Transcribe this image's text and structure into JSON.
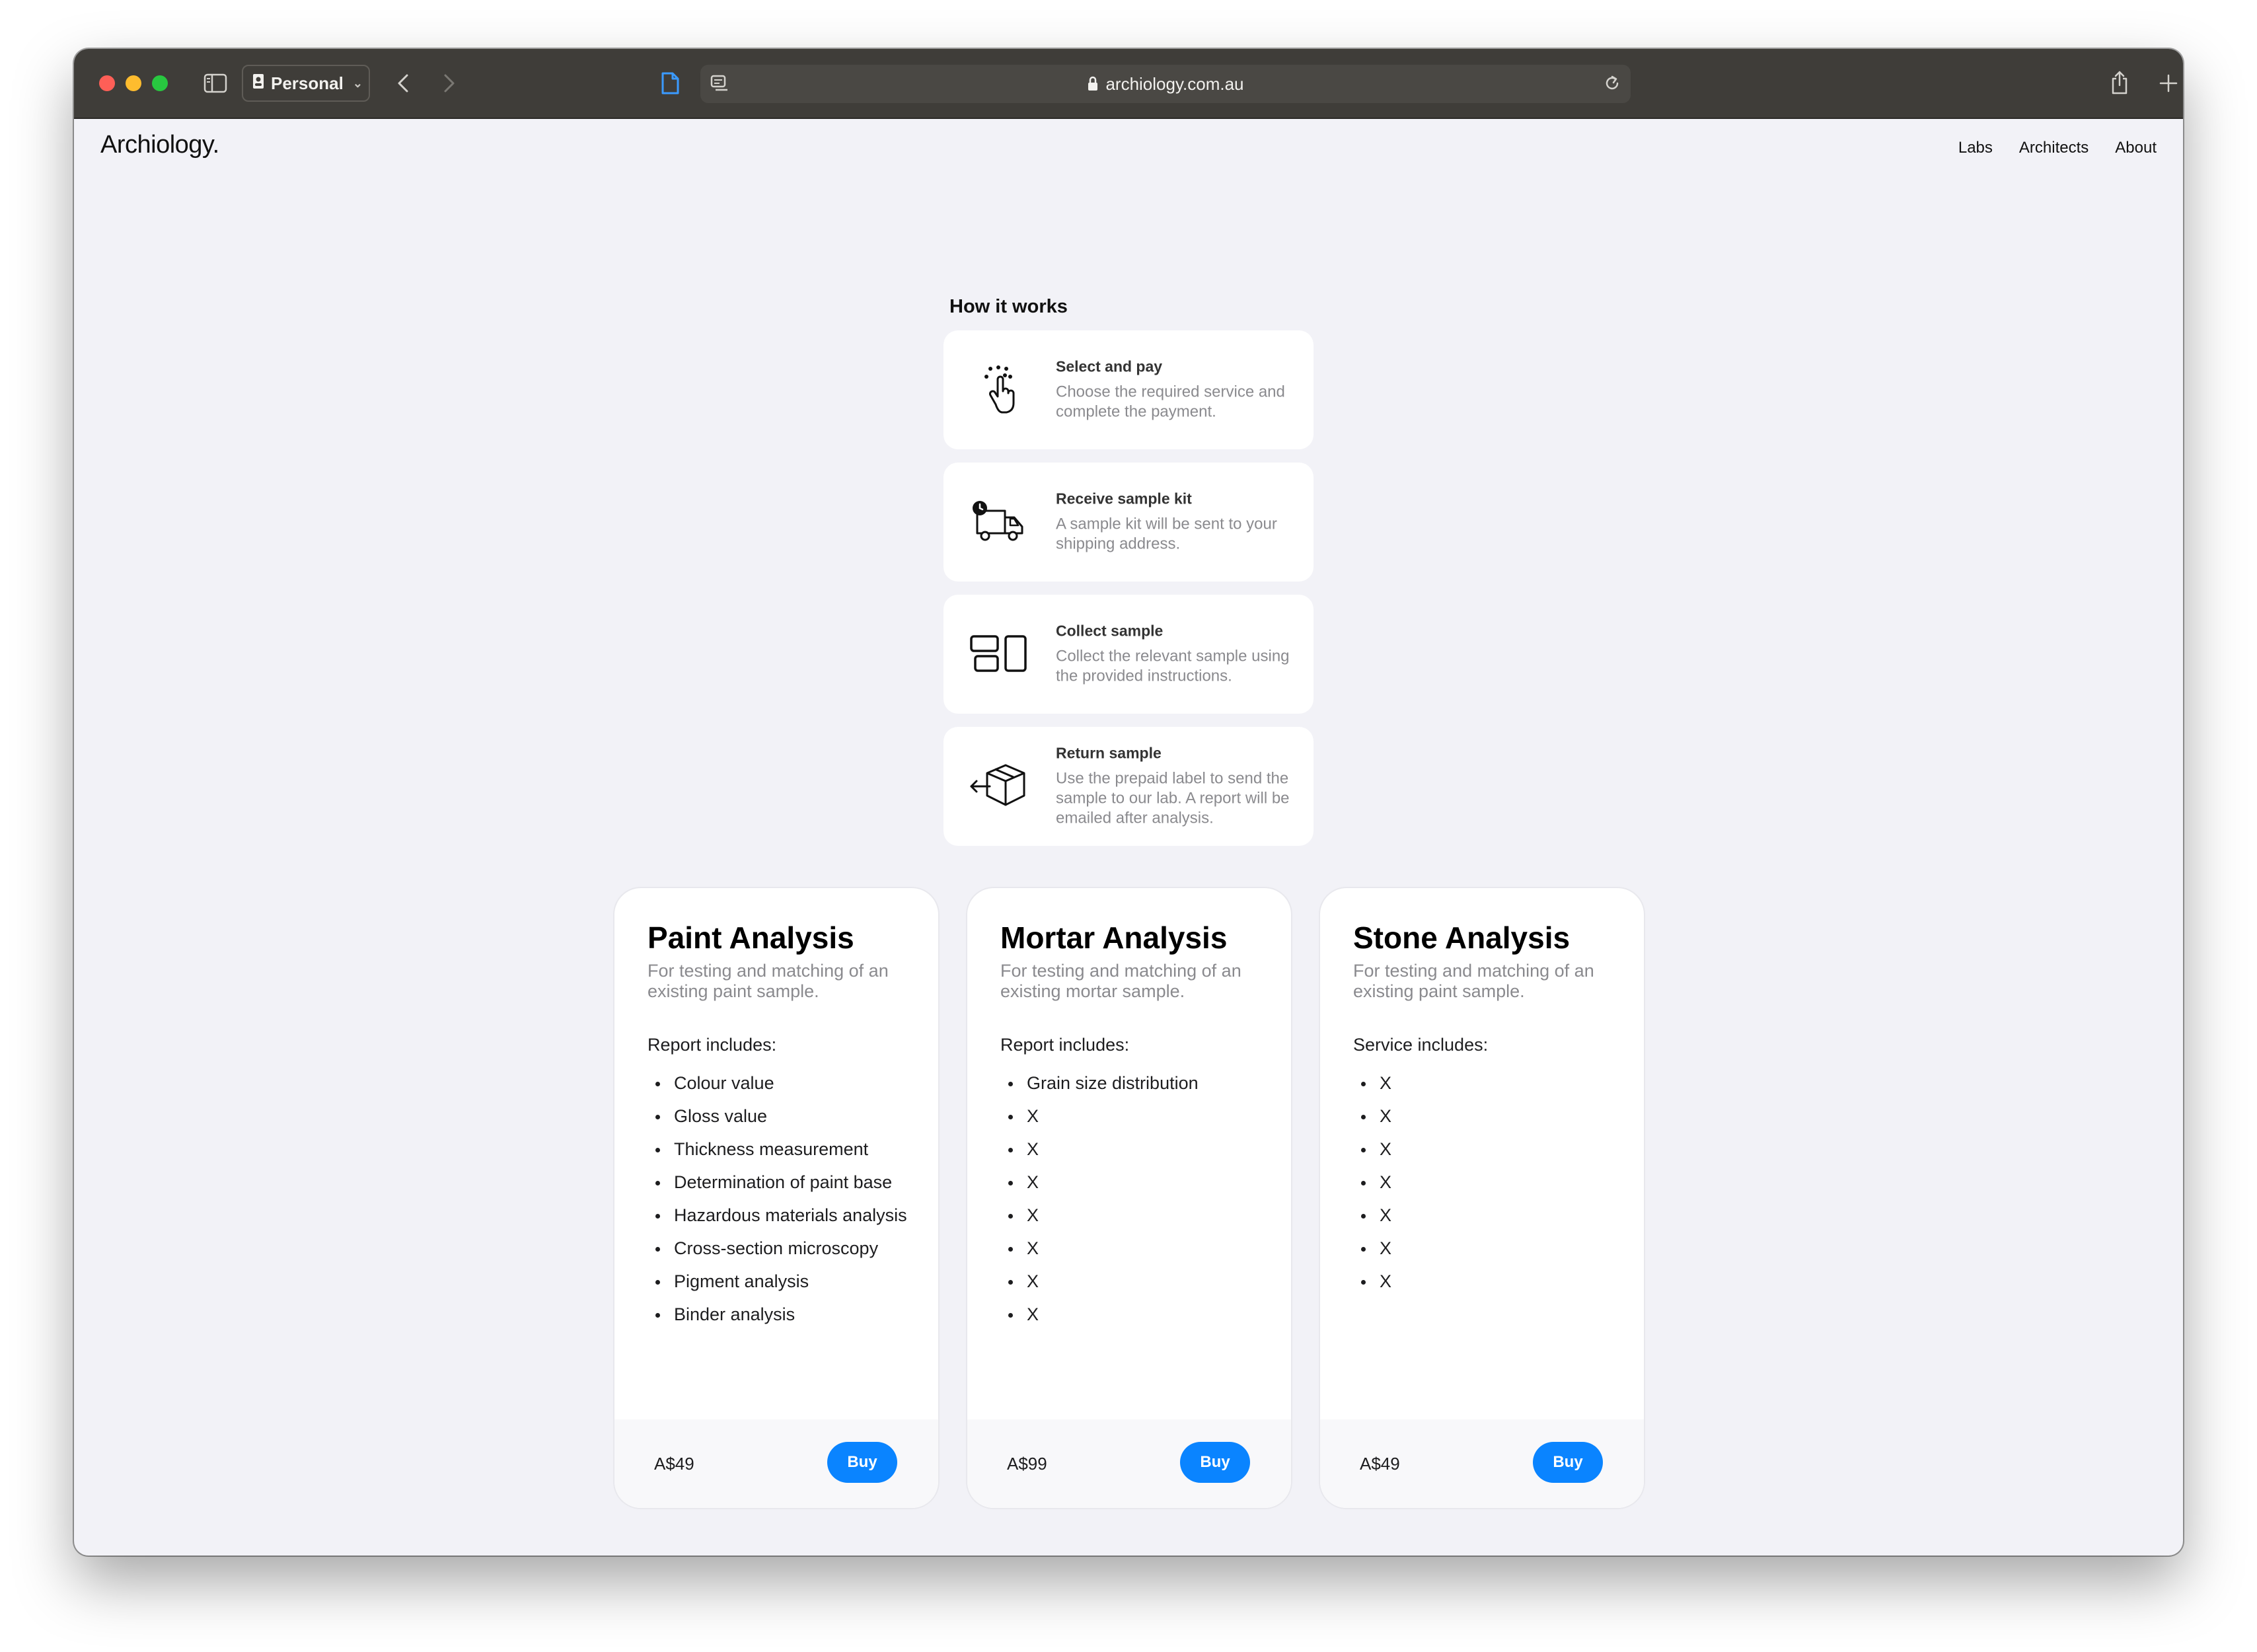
{
  "browser": {
    "profile": "Personal",
    "url": "archiology.com.au"
  },
  "site": {
    "logo": "Archiology.",
    "nav": [
      "Labs",
      "Architects",
      "About"
    ]
  },
  "how": {
    "title": "How it works",
    "steps": [
      {
        "title": "Select and pay",
        "desc": "Choose the required service and complete the payment.",
        "icon": "tap-hand-icon"
      },
      {
        "title": "Receive sample kit",
        "desc": "A sample kit will be sent to your shipping address.",
        "icon": "delivery-truck-icon"
      },
      {
        "title": "Collect sample",
        "desc": "Collect the relevant sample using the provided instructions.",
        "icon": "collect-layout-icon"
      },
      {
        "title": "Return sample",
        "desc": "Use the prepaid label to send the sample to our lab. A report will be emailed after analysis.",
        "icon": "return-box-icon"
      }
    ]
  },
  "cards": [
    {
      "title": "Paint Analysis",
      "subtitle": "For testing and matching of an existing paint sample.",
      "includes_label": "Report includes:",
      "items": [
        "Colour value",
        "Gloss value",
        "Thickness measurement",
        "Determination of paint base",
        "Hazardous materials analysis",
        "Cross-section microscopy",
        "Pigment analysis",
        "Binder analysis"
      ],
      "price": "A$49",
      "buy": "Buy"
    },
    {
      "title": "Mortar Analysis",
      "subtitle": "For testing and matching of an existing mortar sample.",
      "includes_label": "Report includes:",
      "items": [
        "Grain size distribution",
        "X",
        "X",
        "X",
        "X",
        "X",
        "X",
        "X"
      ],
      "price": "A$99",
      "buy": "Buy"
    },
    {
      "title": "Stone Analysis",
      "subtitle": "For testing and matching of an existing paint sample.",
      "includes_label": "Service includes:",
      "items": [
        "X",
        "X",
        "X",
        "X",
        "X",
        "X",
        "X"
      ],
      "price": "A$49",
      "buy": "Buy"
    }
  ],
  "colors": {
    "accent": "#0a84ff",
    "page_bg": "#f2f2f7",
    "toolbar_bg": "#3f3d39"
  }
}
